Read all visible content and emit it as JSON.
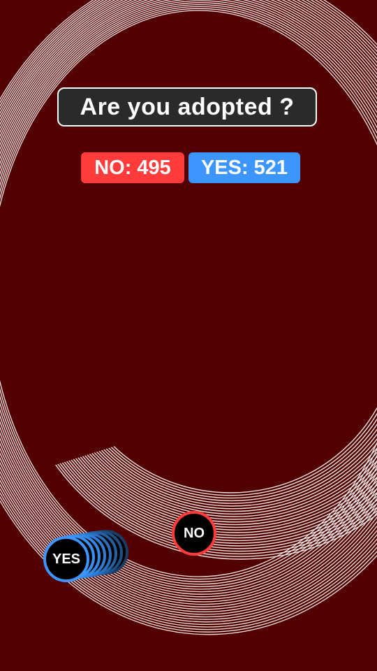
{
  "question": "Are you adopted ?",
  "scores": {
    "no_label": "NO: 495",
    "yes_label": "YES: 521"
  },
  "balls": {
    "no_label": "NO",
    "yes_label": "YES"
  },
  "colors": {
    "background": "#520000",
    "no": "#ff3b3b",
    "yes": "#3d95ff",
    "question_box": "#2a2a2a",
    "rings": "#ffffff"
  }
}
